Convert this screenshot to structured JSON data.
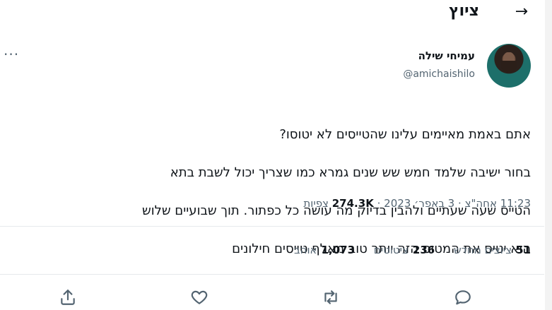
{
  "header": {
    "title": "ציוץ",
    "back_icon": "arrow-right-icon"
  },
  "author": {
    "display_name": "עמיחי שילה",
    "handle": "@amichaishilo"
  },
  "tweet": {
    "lines": [
      "אתם באמת מאיימים עלינו שהטייסים לא יטוסו?",
      "בחור ישיבה שלמד חמש שש שנים גמרא כמו שצריך יכול לשבת בתא",
      "הטייס שעה שעתיים ולהבין בדיוק מה עושה כל כפתור. תוך שבועיים שלוש",
      "הוא יטיס את המטוס הזה יותר טוב מאלף טייסים חילונים"
    ],
    "time": "11:23 אחה\"צ",
    "date": "3 באפר׳ 2023",
    "separator": "·",
    "views_count": "274.3K",
    "views_label": "צפיות"
  },
  "stats": {
    "retweets_count": "51",
    "retweets_label": "ציוצים מחדש",
    "quotes_count": "236",
    "quotes_label": "ציטוטים",
    "likes_count": "1,073",
    "likes_label": "אוהב"
  },
  "actions": [
    "reply-icon",
    "retweet-icon",
    "like-icon",
    "share-icon"
  ],
  "colors": {
    "text": "#0f1419",
    "secondary": "#536471",
    "divider": "#e6e9ec"
  }
}
